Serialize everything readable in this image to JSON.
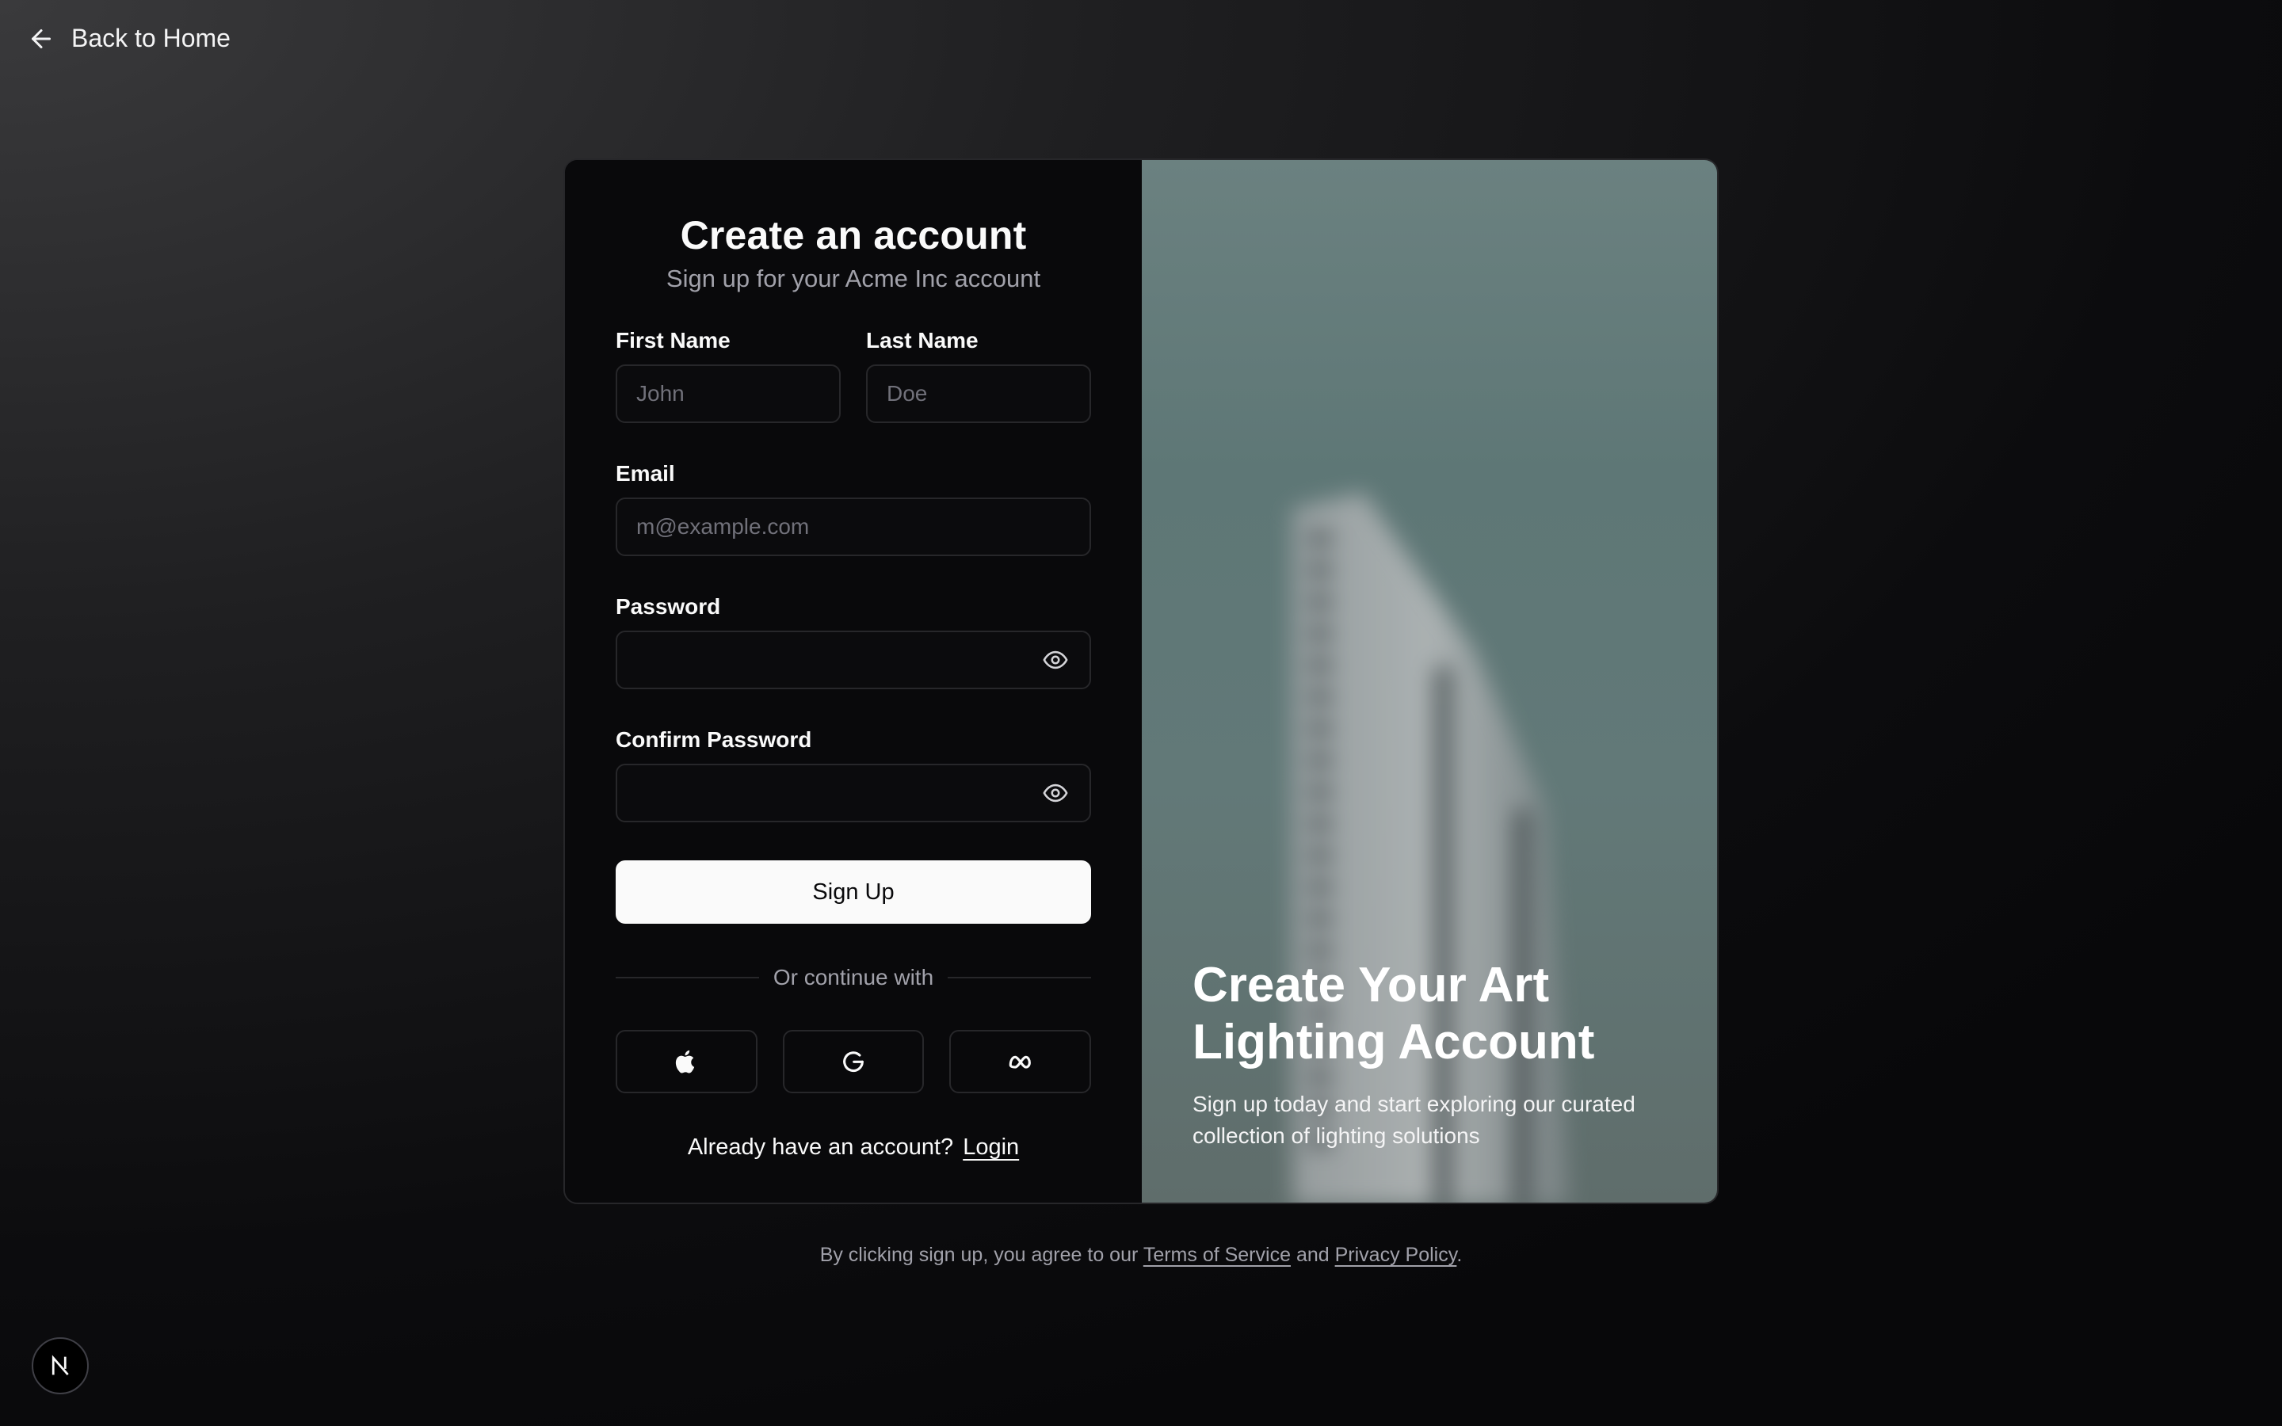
{
  "back_link": {
    "label": "Back to Home",
    "icon": "arrow-left-icon"
  },
  "form": {
    "title": "Create an account",
    "subtitle": "Sign up for your Acme Inc account",
    "first_name": {
      "label": "First Name",
      "placeholder": "John"
    },
    "last_name": {
      "label": "Last Name",
      "placeholder": "Doe"
    },
    "email": {
      "label": "Email",
      "placeholder": "m@example.com"
    },
    "password": {
      "label": "Password",
      "icon": "eye-icon"
    },
    "confirm_password": {
      "label": "Confirm Password",
      "icon": "eye-icon"
    },
    "submit_label": "Sign Up",
    "divider_text": "Or continue with",
    "social": [
      {
        "name": "apple",
        "icon": "apple-icon"
      },
      {
        "name": "google",
        "icon": "google-icon"
      },
      {
        "name": "meta",
        "icon": "meta-icon"
      }
    ],
    "already_text": "Already have an account?",
    "login_label": "Login"
  },
  "hero": {
    "title": "Create Your Art Lighting Account",
    "subtitle": "Sign up today and start exploring our curated collection of lighting solutions"
  },
  "terms": {
    "prefix": "By clicking sign up, you agree to our",
    "tos_label": "Terms of Service",
    "and": "and",
    "privacy_label": "Privacy Policy",
    "suffix": "."
  },
  "badge": {
    "letter": "N",
    "icon": "nextjs-icon"
  },
  "colors": {
    "background": "#09090b",
    "border": "#27272a",
    "muted": "#a1a1aa",
    "primary_button": "#fafafa"
  }
}
